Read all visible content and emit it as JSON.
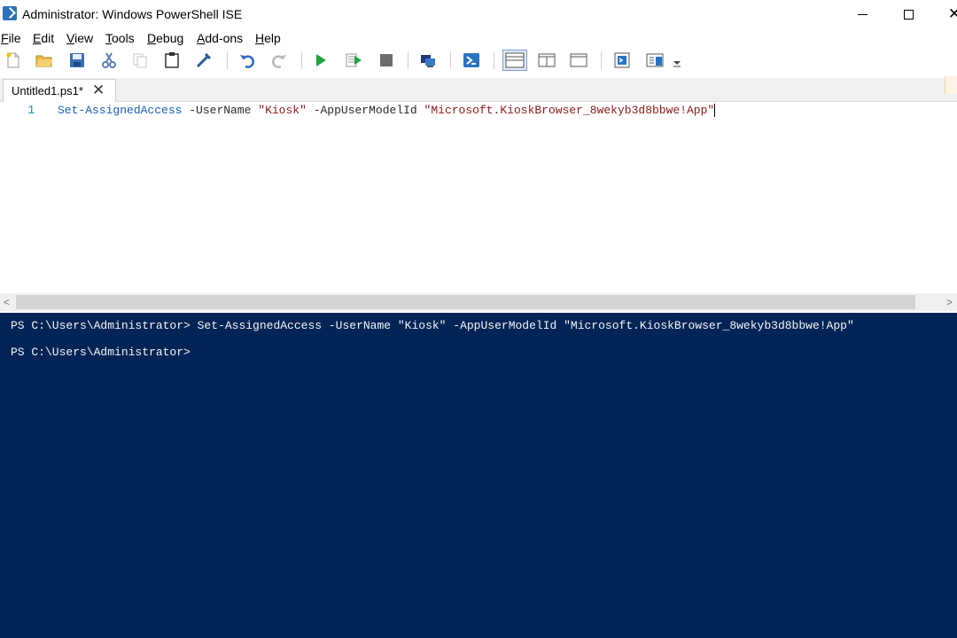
{
  "window": {
    "title": "Administrator: Windows PowerShell ISE",
    "icon": "powershell-ise-icon",
    "controls": {
      "minimize": "minimize-icon",
      "maximize": "maximize-icon",
      "close": "✕"
    }
  },
  "menu": {
    "items": [
      {
        "label": "File",
        "u": "F",
        "rest": "ile"
      },
      {
        "label": "Edit",
        "u": "E",
        "rest": "dit"
      },
      {
        "label": "View",
        "u": "V",
        "rest": "iew"
      },
      {
        "label": "Tools",
        "u": "T",
        "rest": "ools"
      },
      {
        "label": "Debug",
        "u": "D",
        "rest": "ebug"
      },
      {
        "label": "Add-ons",
        "u": "A",
        "rest": "dd-ons"
      },
      {
        "label": "Help",
        "u": "H",
        "rest": "elp"
      }
    ]
  },
  "toolbar": {
    "buttons": [
      "new-file-icon",
      "open-folder-icon",
      "save-icon",
      "cut-icon",
      "copy-icon",
      "paste-icon",
      "clear-console-icon",
      "undo-icon",
      "redo-icon",
      "run-icon",
      "run-selection-icon",
      "stop-icon",
      "remote-tab-icon",
      "start-powershell-icon",
      "script-top-layout-icon",
      "script-right-layout-icon",
      "script-maximized-layout-icon",
      "show-commands-icon",
      "show-command-addon-icon",
      "toolbar-overflow-icon"
    ]
  },
  "tabs": [
    {
      "label": "Untitled1.ps1*",
      "close": "✕"
    }
  ],
  "editor": {
    "line_number": "1",
    "tokens": {
      "cmdlet": "Set-AssignedAccess",
      "param1": "-UserName",
      "value1": "\"Kiosk\"",
      "param2": "-AppUserModelId",
      "value2": "\"Microsoft.KioskBrowser_8wekyb3d8bbwe!App\""
    }
  },
  "scrollbar": {
    "left_arrow": "<",
    "right_arrow": ">"
  },
  "console": {
    "lines": [
      "PS C:\\Users\\Administrator> Set-AssignedAccess -UserName \"Kiosk\" -AppUserModelId \"Microsoft.KioskBrowser_8wekyb3d8bbwe!App\"",
      "PS C:\\Users\\Administrator>"
    ],
    "background": "#012456"
  }
}
